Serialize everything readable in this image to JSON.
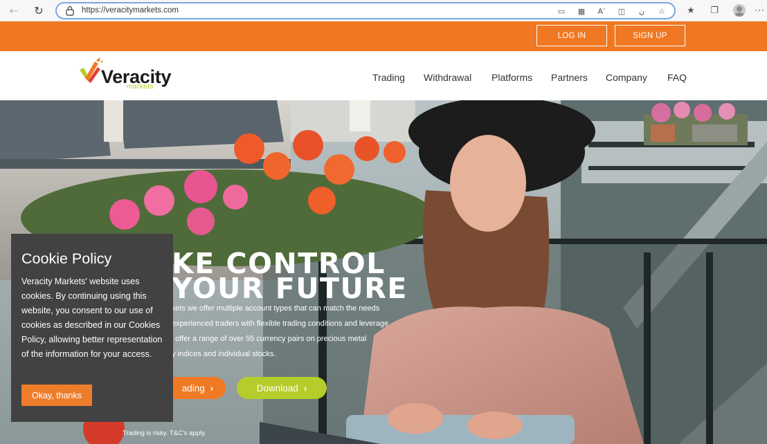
{
  "browser": {
    "url": "https://veracitymarkets.com",
    "icons": [
      "back-icon",
      "refresh-icon",
      "lock-icon",
      "reader-icon",
      "qr-icon",
      "read-aloud-icon",
      "immersive-reader-icon",
      "translate-icon",
      "favorites-add-icon",
      "favorites-icon",
      "collections-icon",
      "profile-icon",
      "more-icon"
    ]
  },
  "topbar": {
    "login_label": "LOG IN",
    "signup_label": "SIGN UP",
    "color": "#f17822"
  },
  "header": {
    "logo_word": "Veracity",
    "logo_sub": "markets",
    "menu": [
      "Trading",
      "Withdrawal",
      "Platforms",
      "Partners",
      "Company",
      "FAQ"
    ]
  },
  "hero": {
    "title_line1": "KE CONTROL",
    "title_line2": "YOUR FUTURE",
    "lines": [
      "rkets we offer multiple account types that can match the needs",
      "experienced traders with flexible trading conditions and leverage",
      "e offer a range of over 55 currency pairs on precious metal",
      "y indices and individual stocks."
    ],
    "trading_button": "ading",
    "download_button": "Download",
    "risk_note": "Trading is risky. T&C's apply.",
    "trading_color": "#f07a24",
    "download_color": "#b5cc2a"
  },
  "cookie": {
    "title": "Cookie Policy",
    "body": "Veracity Markets' website uses cookies. By continuing using this website, you consent to our use of cookies as described in our Cookies Policy, allowing better representation of the information for your access.",
    "button": "Okay, thanks",
    "background": "#424242"
  }
}
